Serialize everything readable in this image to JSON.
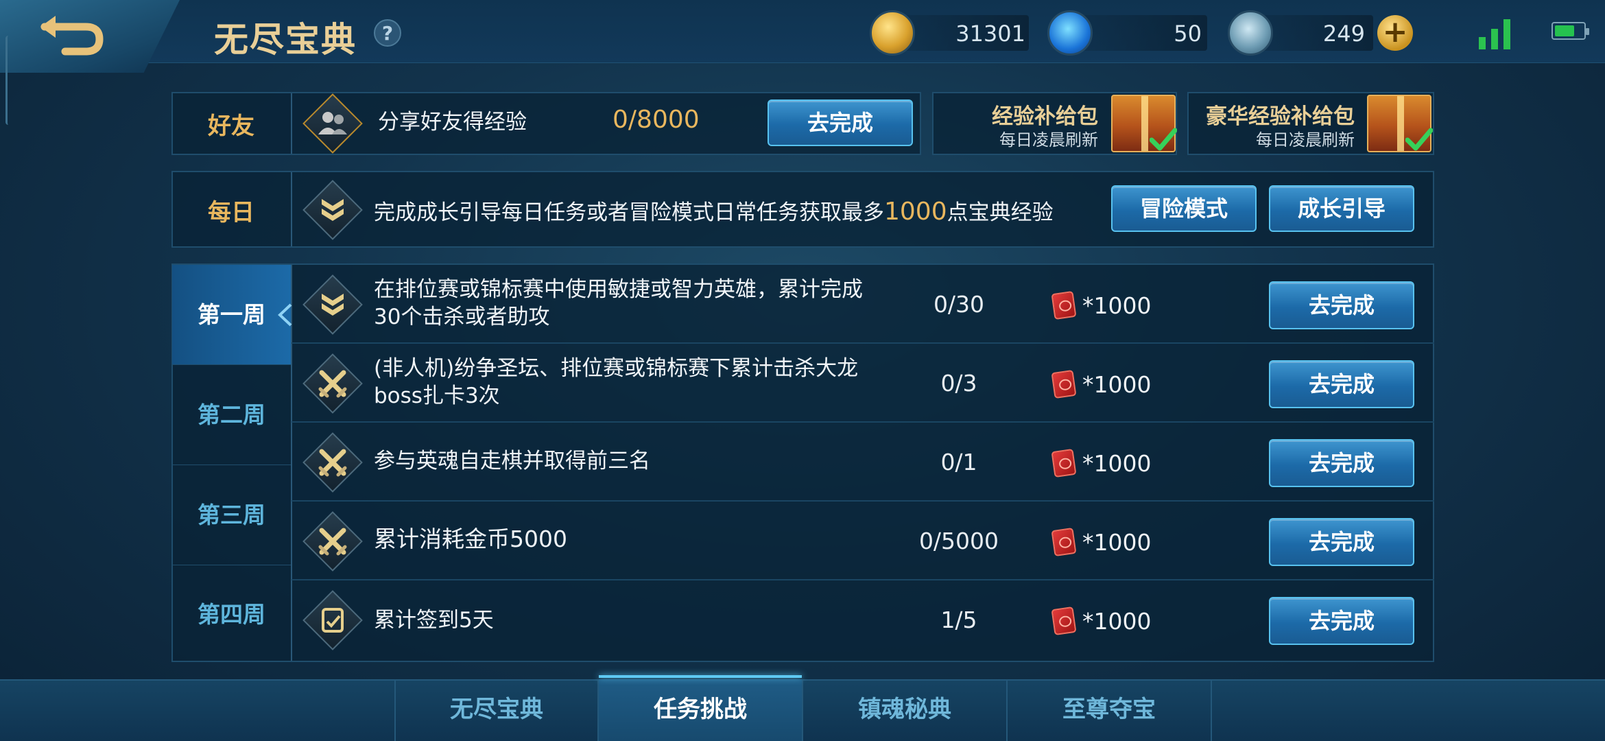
{
  "header": {
    "title": "无尽宝典",
    "help_label": "?",
    "currencies": {
      "gold": "31301",
      "gems": "50",
      "coupons": "249"
    },
    "add_label": "+"
  },
  "friend_row": {
    "label": "好友",
    "text": "分享好友得经验",
    "progress": "0/8000",
    "button": "去完成"
  },
  "supply_packs": [
    {
      "title": "经验补给包",
      "subtitle": "每日凌晨刷新"
    },
    {
      "title": "豪华经验补给包",
      "subtitle": "每日凌晨刷新"
    }
  ],
  "daily_row": {
    "label": "每日",
    "text_before": "完成成长引导每日任务或者冒险模式日常任务获取最多",
    "text_highlight": "1000",
    "text_after": "点宝典经验",
    "button_adventure": "冒险模式",
    "button_growth": "成长引导"
  },
  "weeks": [
    "第一周",
    "第二周",
    "第三周",
    "第四周"
  ],
  "tasks": [
    {
      "text": "在排位赛或锦标赛中使用敏捷或智力英雄，累计完成30个击杀或者助攻",
      "progress": "0/30",
      "reward": "*1000",
      "button": "去完成",
      "icon": "rank-badge-icon"
    },
    {
      "text": "(非人机)纷争圣坛、排位赛或锦标赛下累计击杀大龙boss扎卡3次",
      "progress": "0/3",
      "reward": "*1000",
      "button": "去完成",
      "icon": "crossed-swords-icon"
    },
    {
      "text": "参与英魂自走棋并取得前三名",
      "progress": "0/1",
      "reward": "*1000",
      "button": "去完成",
      "icon": "crossed-swords-icon"
    },
    {
      "text": "累计消耗金币5000",
      "progress": "0/5000",
      "reward": "*1000",
      "button": "去完成",
      "icon": "crossed-swords-icon"
    },
    {
      "text": "累计签到5天",
      "progress": "1/5",
      "reward": "*1000",
      "button": "去完成",
      "icon": "sign-in-card-icon"
    }
  ],
  "bottom_tabs": [
    "无尽宝典",
    "任务挑战",
    "镇魂秘典",
    "至尊夺宝"
  ]
}
